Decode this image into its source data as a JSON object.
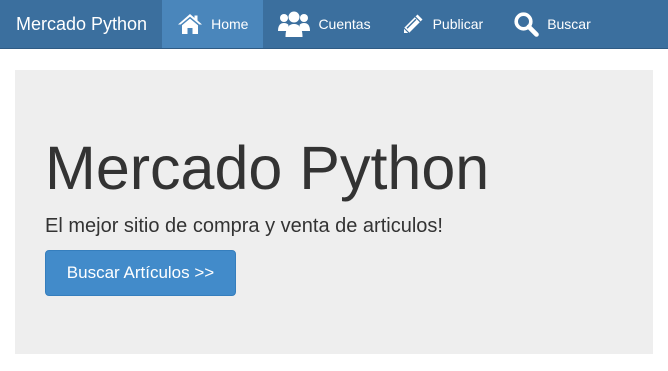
{
  "navbar": {
    "brand": "Mercado Python",
    "items": [
      {
        "label": "Home",
        "icon": "home-icon",
        "active": true
      },
      {
        "label": "Cuentas",
        "icon": "users-icon",
        "active": false
      },
      {
        "label": "Publicar",
        "icon": "pencil-icon",
        "active": false
      },
      {
        "label": "Buscar",
        "icon": "search-icon",
        "active": false
      }
    ]
  },
  "jumbotron": {
    "title": "Mercado Python",
    "subtitle": "El mejor sitio de compra y venta de articulos!",
    "button_label": "Buscar Artículos >>"
  },
  "colors": {
    "navbar_bg": "#3b6f9e",
    "navbar_active_bg": "#4a86bb",
    "jumbotron_bg": "#eeeeee",
    "button_bg": "#428bca",
    "text": "#333333"
  }
}
